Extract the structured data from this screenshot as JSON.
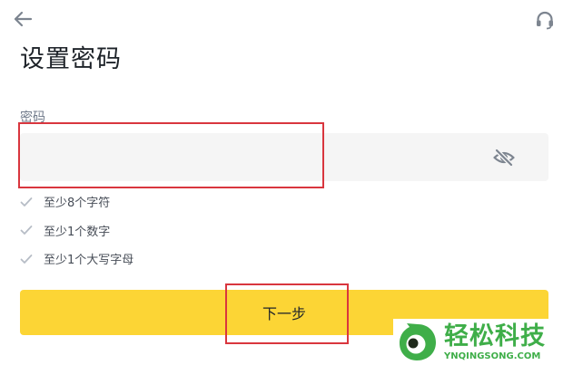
{
  "header": {
    "back_icon": "arrow-left-icon",
    "support_icon": "headset-icon",
    "title": "设置密码"
  },
  "password_field": {
    "label": "密码",
    "value": "",
    "placeholder": "",
    "visibility_icon": "eye-off-icon"
  },
  "rules": [
    {
      "icon": "check-icon",
      "text": "至少8个字符"
    },
    {
      "icon": "check-icon",
      "text": "至少1个数字"
    },
    {
      "icon": "check-icon",
      "text": "至少1个大写字母"
    }
  ],
  "next_button": {
    "label": "下一步"
  },
  "watermark": {
    "name": "轻松科技",
    "domain": "YNQINGSONG.COM"
  },
  "colors": {
    "accent": "#fcd535",
    "highlight": "#d9363e",
    "field_bg": "#f5f5f5",
    "watermark": "#3fae49"
  }
}
